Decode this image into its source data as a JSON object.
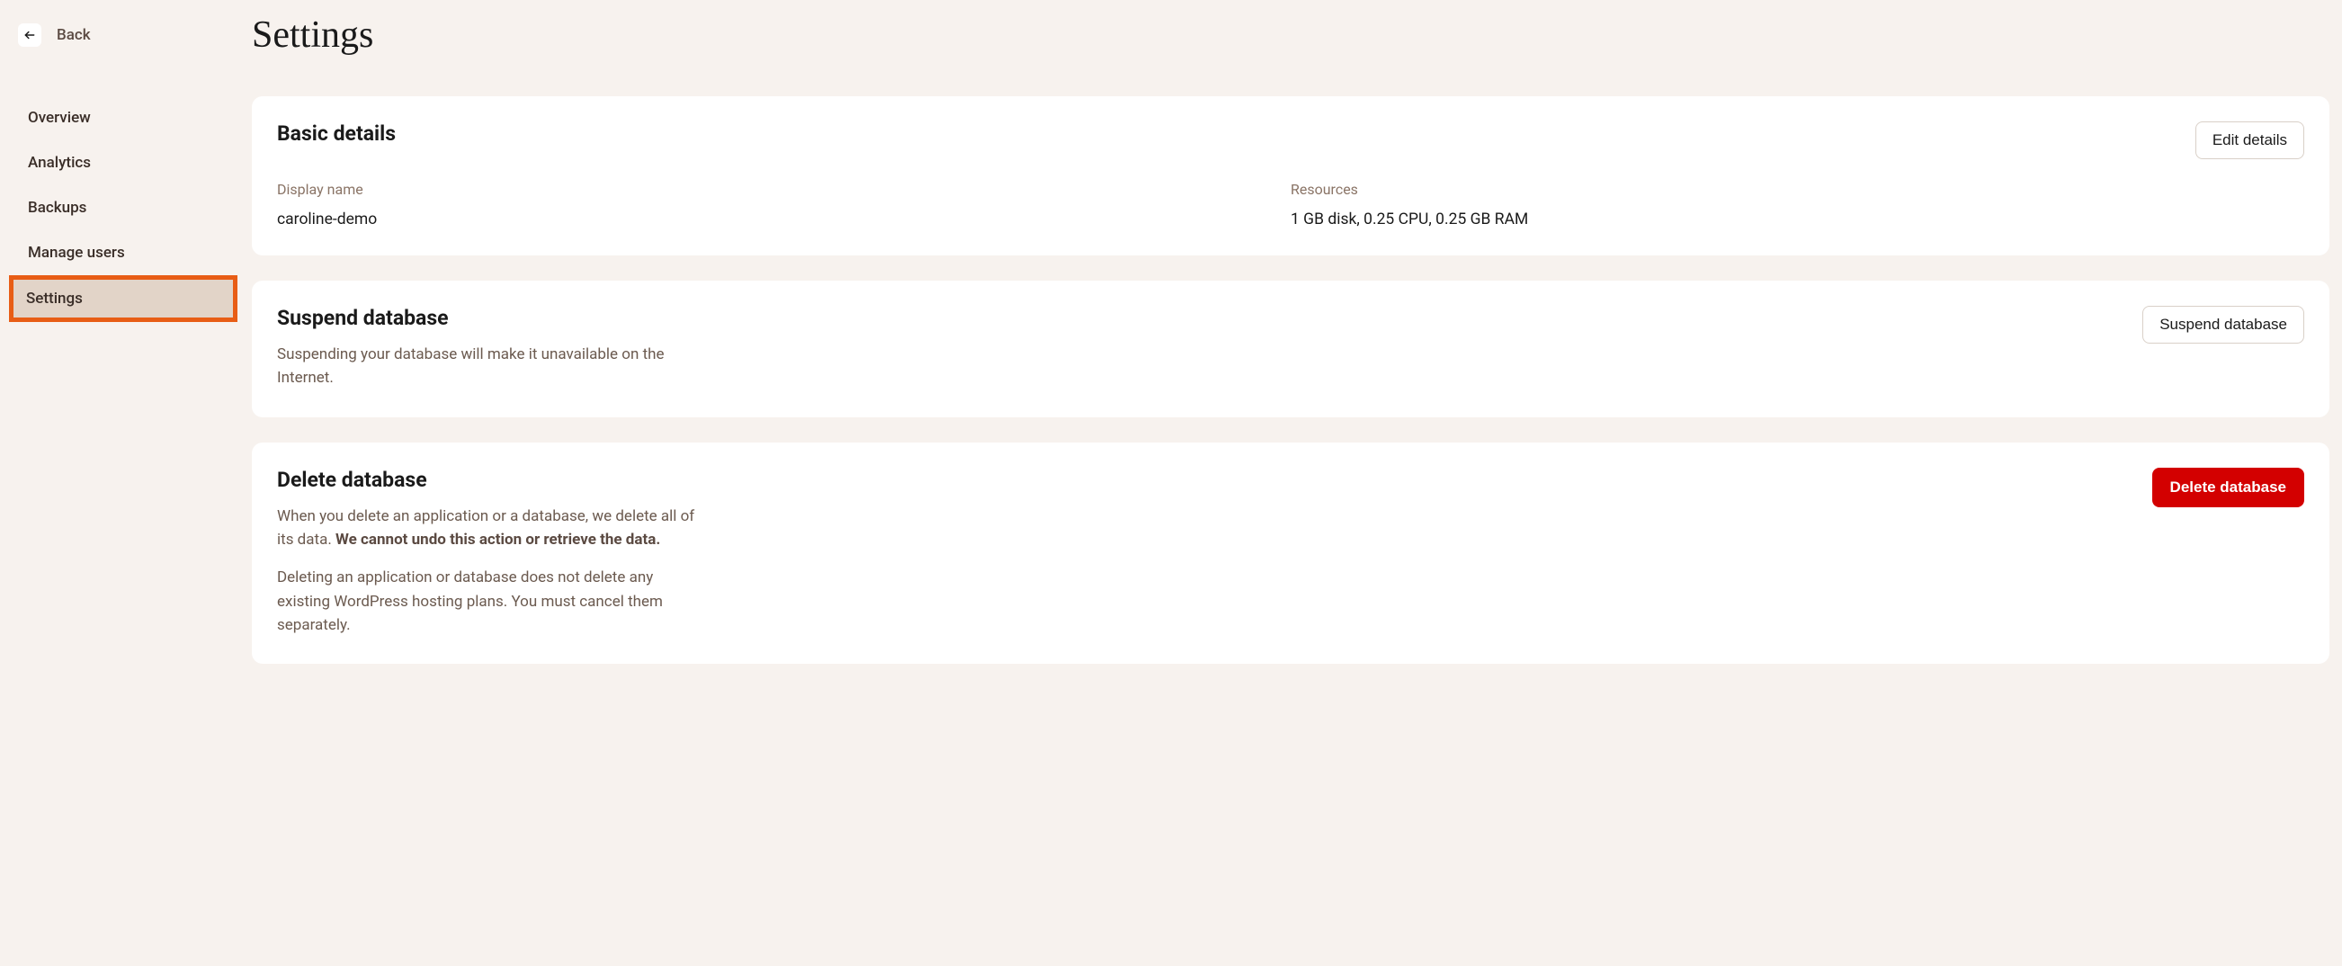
{
  "sidebar": {
    "back_label": "Back",
    "items": [
      {
        "label": "Overview",
        "active": false
      },
      {
        "label": "Analytics",
        "active": false
      },
      {
        "label": "Backups",
        "active": false
      },
      {
        "label": "Manage users",
        "active": false
      },
      {
        "label": "Settings",
        "active": true
      }
    ]
  },
  "page": {
    "title": "Settings"
  },
  "basic_details": {
    "title": "Basic details",
    "edit_button": "Edit details",
    "display_name_label": "Display name",
    "display_name_value": "caroline-demo",
    "resources_label": "Resources",
    "resources_value": "1 GB disk, 0.25 CPU, 0.25 GB RAM"
  },
  "suspend": {
    "title": "Suspend database",
    "description": "Suspending your database will make it unavailable on the Internet.",
    "button": "Suspend database"
  },
  "delete": {
    "title": "Delete database",
    "description_1a": "When you delete an application or a database, we delete all of its data. ",
    "description_1b": "We cannot undo this action or retrieve the data.",
    "description_2": "Deleting an application or database does not delete any existing WordPress hosting plans. You must cancel them separately.",
    "button": "Delete database"
  }
}
